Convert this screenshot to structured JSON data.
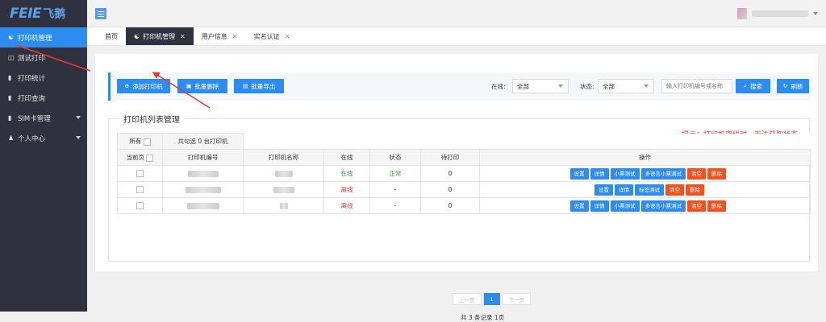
{
  "brand": {
    "logo_text": "FEIE",
    "logo_cn": "飞鹅"
  },
  "sidebar": {
    "items": [
      {
        "label": "打印机管理",
        "icon": "printer-group-icon",
        "active": true
      },
      {
        "label": "测试打印",
        "icon": "print-test-icon"
      },
      {
        "label": "打印统计",
        "icon": "stats-icon"
      },
      {
        "label": "打印查询",
        "icon": "query-icon"
      },
      {
        "label": "SIM卡管理",
        "icon": "sim-icon",
        "expandable": true
      },
      {
        "label": "个人中心",
        "icon": "user-icon",
        "expandable": true
      }
    ]
  },
  "tabs": [
    {
      "label": "首页"
    },
    {
      "label": "打印机管理",
      "active": true
    },
    {
      "label": "用户信息"
    },
    {
      "label": "实名认证"
    }
  ],
  "toolbar": {
    "add_label": "添加打印机",
    "batch_delete_label": "批量删除",
    "batch_export_label": "批量导出",
    "online_label": "在线:",
    "online_value": "全部",
    "status_label": "状态:",
    "status_value": "全部",
    "search_placeholder": "输入打印机编号或名称",
    "search_label": "搜索",
    "refresh_label": "刷新"
  },
  "list": {
    "legend": "打印机列表管理",
    "hint": "提示：打印机离线时，无法获取状态",
    "select_all_label": "所有",
    "select_page_label": "当前页",
    "selected_text": "共勾选 0 台打印机",
    "columns": [
      "打印机编号",
      "打印机名称",
      "在线",
      "状态",
      "待打印",
      "操作"
    ],
    "rows": [
      {
        "online": "在线",
        "status": "正常",
        "pending": "0",
        "actions": [
          "设置",
          "详情",
          "小票测试",
          "多语言小票测试",
          "清空",
          "删除"
        ]
      },
      {
        "online": "离线",
        "status": "-",
        "pending": "0",
        "actions": [
          "设置",
          "详情",
          "标签测试",
          "清空",
          "删除"
        ]
      },
      {
        "online": "离线",
        "status": "-",
        "pending": "0",
        "actions": [
          "设置",
          "详情",
          "小票测试",
          "多语言小票测试",
          "清空",
          "删除"
        ]
      }
    ]
  },
  "pagination": {
    "prev_label": "上一页",
    "current_page": "1",
    "next_label": "下一页",
    "summary": "共 3 条记录 1页"
  },
  "colors": {
    "accent": "#2d8cf0",
    "danger": "#f4511e",
    "sidebar": "#2f323e",
    "online": "#2e9e3d",
    "offline": "#e53935"
  }
}
